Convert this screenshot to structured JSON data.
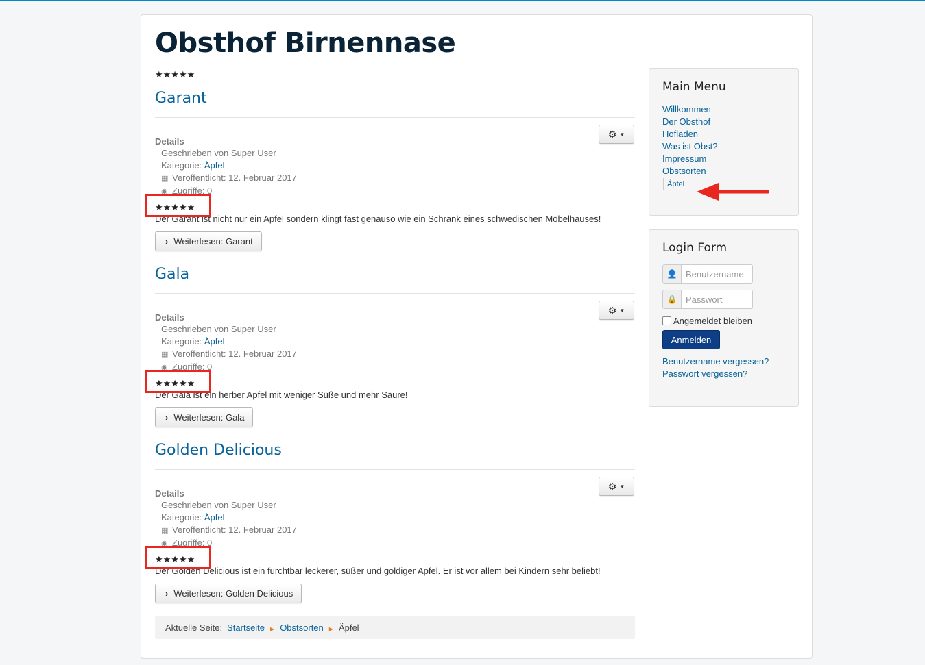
{
  "site": {
    "title": "Obsthof Birnennase",
    "rating": "★★★★★"
  },
  "articles": [
    {
      "title": "Garant",
      "details_label": "Details",
      "author": "Geschrieben von Super User",
      "category_label": "Kategorie: ",
      "category": "Äpfel",
      "published": "Veröffentlicht: 12. Februar 2017",
      "hits": "Zugriffe: 0",
      "rating": "★★★★★",
      "intro": "Der Garant ist nicht nur ein Apfel sondern klingt fast genauso wie ein Schrank eines schwedischen Möbelhauses!",
      "readmore": "Weiterlesen: Garant"
    },
    {
      "title": "Gala",
      "details_label": "Details",
      "author": "Geschrieben von Super User",
      "category_label": "Kategorie: ",
      "category": "Äpfel",
      "published": "Veröffentlicht: 12. Februar 2017",
      "hits": "Zugriffe: 0",
      "rating": "★★★★★",
      "intro": "Der Gala ist ein herber Apfel mit weniger Süße und mehr Säure!",
      "readmore": "Weiterlesen: Gala"
    },
    {
      "title": "Golden Delicious",
      "details_label": "Details",
      "author": "Geschrieben von Super User",
      "category_label": "Kategorie: ",
      "category": "Äpfel",
      "published": "Veröffentlicht: 12. Februar 2017",
      "hits": "Zugriffe: 0",
      "rating": "★★★★★",
      "intro": "Der Golden Delicious ist ein furchtbar leckerer, süßer und goldiger Apfel. Er ist vor allem bei Kindern sehr beliebt!",
      "readmore": "Weiterlesen: Golden Delicious"
    }
  ],
  "breadcrumb": {
    "label": "Aktuelle Seite:",
    "items": [
      "Startseite",
      "Obstsorten"
    ],
    "current": "Äpfel"
  },
  "main_menu": {
    "title": "Main Menu",
    "items": [
      "Willkommen",
      "Der Obsthof",
      "Hofladen",
      "Was ist Obst?",
      "Impressum",
      "Obstsorten"
    ],
    "sub_item": "Äpfel"
  },
  "login": {
    "title": "Login Form",
    "username_placeholder": "Benutzername",
    "password_placeholder": "Passwort",
    "remember": "Angemeldet bleiben",
    "submit": "Anmelden",
    "forgot_username": "Benutzername vergessen?",
    "forgot_password": "Passwort vergessen?"
  },
  "colors": {
    "annotation": "#e8281e",
    "link": "#08639a",
    "button_primary": "#0e3f86"
  },
  "icons": {
    "gear": "gear-icon",
    "user": "user-icon",
    "lock": "lock-icon",
    "calendar": "calendar-icon",
    "eye": "eye-icon"
  }
}
